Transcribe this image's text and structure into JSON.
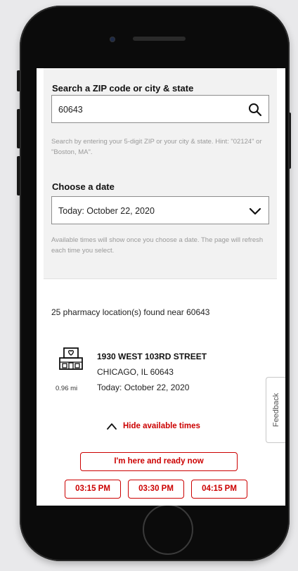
{
  "search": {
    "label": "Search a ZIP code or city & state",
    "value": "60643",
    "hint": "Search by entering your 5-digit ZIP or your city & state. Hint: \"02124\" or \"Boston, MA\"."
  },
  "date": {
    "label": "Choose a date",
    "selected": "Today: October 22, 2020",
    "hint": "Available times will show once you choose a date. The page will refresh each time you select."
  },
  "results": {
    "found_text": "25 pharmacy location(s) found near 60643"
  },
  "store": {
    "address": "1930 WEST 103RD STREET",
    "city": "CHICAGO, IL 60643",
    "date": "Today: October 22, 2020",
    "distance": "0.96 mi"
  },
  "times": {
    "toggle_label": "Hide available times",
    "ready_label": "I'm here and ready now",
    "slots": [
      "03:15 PM",
      "03:30 PM",
      "04:15 PM"
    ]
  },
  "feedback": {
    "label": "Feedback"
  },
  "colors": {
    "accent": "#cc0000",
    "panel": "#f2f2f2",
    "frame": "#0b0b0b"
  }
}
